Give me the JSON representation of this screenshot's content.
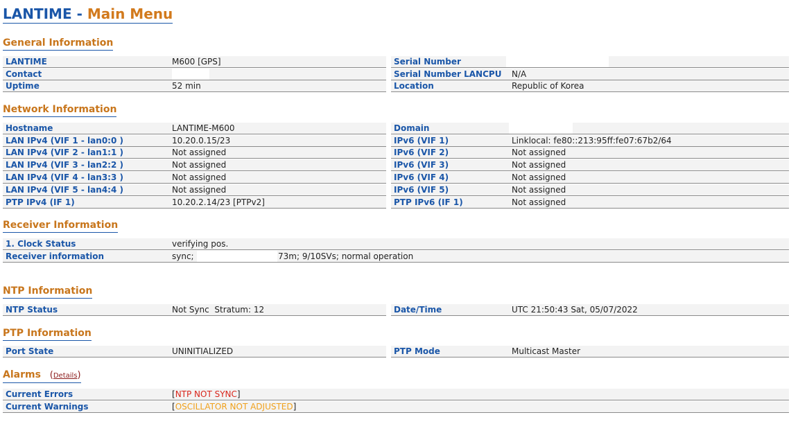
{
  "header": {
    "title_part1": "LANTIME - ",
    "title_part2": "Main Menu"
  },
  "general": {
    "heading": "General Information",
    "left": [
      {
        "label": "LANTIME",
        "value": "M600 [GPS]"
      },
      {
        "label": "Contact",
        "value": ""
      },
      {
        "label": "Uptime",
        "value": "52 min"
      }
    ],
    "right": [
      {
        "label": "Serial Number",
        "value": ""
      },
      {
        "label": "Serial Number LANCPU",
        "value": "N/A"
      },
      {
        "label": "Location",
        "value": "Republic of Korea"
      }
    ]
  },
  "network": {
    "heading": "Network Information",
    "left": [
      {
        "label": "Hostname",
        "value": "LANTIME-M600"
      },
      {
        "label": "LAN IPv4 (VIF 1 - lan0:0 )",
        "value": "10.20.0.15/23"
      },
      {
        "label": "LAN IPv4 (VIF 2 - lan1:1 )",
        "value": "Not assigned"
      },
      {
        "label": "LAN IPv4 (VIF 3 - lan2:2 )",
        "value": "Not assigned"
      },
      {
        "label": "LAN IPv4 (VIF 4 - lan3:3 )",
        "value": "Not assigned"
      },
      {
        "label": "LAN IPv4 (VIF 5 - lan4:4 )",
        "value": "Not assigned"
      },
      {
        "label": "PTP IPv4 (IF 1)",
        "value": "10.20.2.14/23 [PTPv2]"
      }
    ],
    "right": [
      {
        "label": "Domain",
        "value": ""
      },
      {
        "label": "IPv6 (VIF 1)",
        "value": "Linklocal: fe80::213:95ff:fe07:67b2/64"
      },
      {
        "label": "IPv6 (VIF 2)",
        "value": "Not assigned"
      },
      {
        "label": "IPv6 (VIF 3)",
        "value": "Not assigned"
      },
      {
        "label": "IPv6 (VIF 4)",
        "value": "Not assigned"
      },
      {
        "label": "IPv6 (VIF 5)",
        "value": "Not assigned"
      },
      {
        "label": "PTP IPv6 (IF 1)",
        "value": "Not assigned"
      }
    ]
  },
  "receiver": {
    "heading": "Receiver Information",
    "rows": [
      {
        "label": "1. Clock Status",
        "value": "verifying pos."
      },
      {
        "label": "Receiver information",
        "value": "sync;",
        "value2": "73m; 9/10SVs; normal operation"
      }
    ]
  },
  "ntp": {
    "heading": "NTP Information",
    "left": {
      "label": "NTP Status",
      "value": "Not Sync  Stratum: 12"
    },
    "right": {
      "label": "Date/Time",
      "value": "UTC 21:50:43 Sat, 05/07/2022"
    }
  },
  "ptp": {
    "heading": "PTP Information",
    "left": {
      "label": "Port State",
      "value": "UNINITIALIZED"
    },
    "right": {
      "label": "PTP Mode",
      "value": "Multicast Master"
    }
  },
  "alarms": {
    "heading": "Alarms",
    "details_link": "Details",
    "rows": [
      {
        "label": "Current Errors",
        "value": "NTP NOT SYNC",
        "color": "#d9261c"
      },
      {
        "label": "Current Warnings",
        "value": "OSCILLATOR NOT ADJUSTED",
        "color": "#f0a11c"
      }
    ]
  }
}
